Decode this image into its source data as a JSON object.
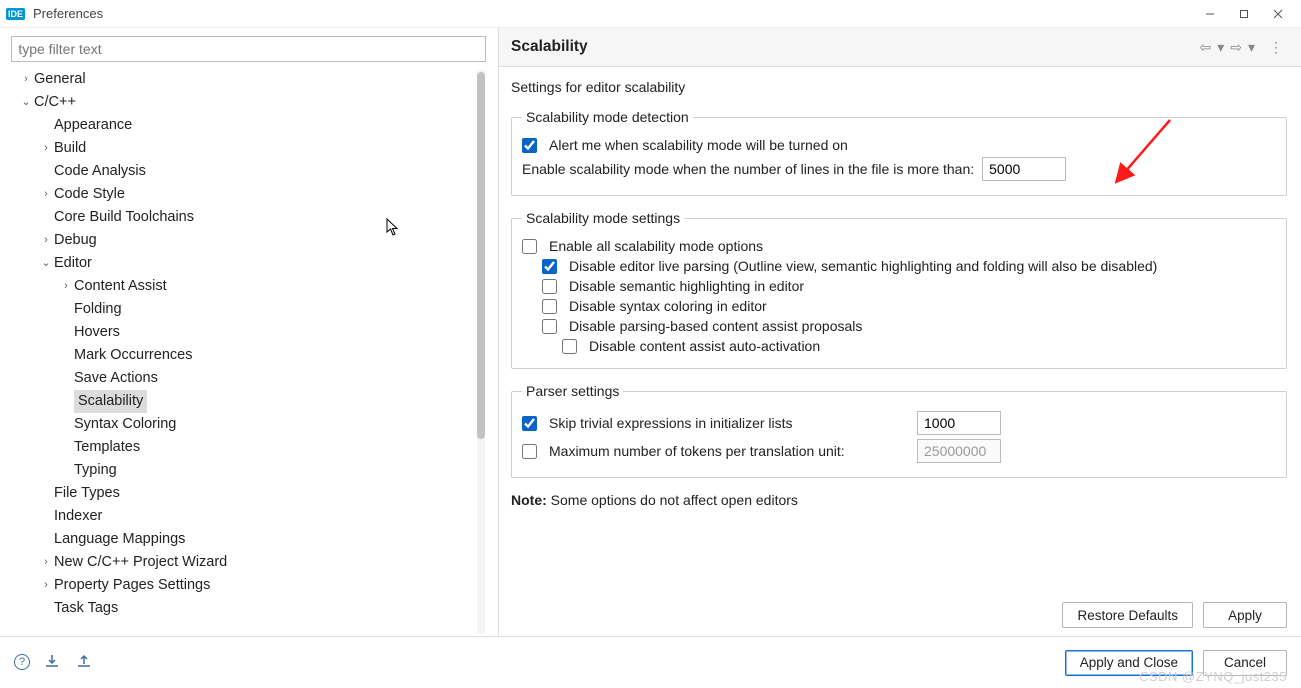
{
  "window": {
    "title": "Preferences"
  },
  "filter_placeholder": "type filter text",
  "tree": {
    "general": "General",
    "ccpp": "C/C++",
    "appearance": "Appearance",
    "build": "Build",
    "code_analysis": "Code Analysis",
    "code_style": "Code Style",
    "core_build": "Core Build Toolchains",
    "debug": "Debug",
    "editor": "Editor",
    "content_assist": "Content Assist",
    "folding": "Folding",
    "hovers": "Hovers",
    "mark_occ": "Mark Occurrences",
    "save_actions": "Save Actions",
    "scalability": "Scalability",
    "syntax_coloring": "Syntax Coloring",
    "templates": "Templates",
    "typing": "Typing",
    "file_types": "File Types",
    "indexer": "Indexer",
    "lang_map": "Language Mappings",
    "new_proj": "New C/C++ Project Wizard",
    "prop_pages": "Property Pages Settings",
    "task_tags": "Task Tags"
  },
  "page": {
    "title": "Scalability",
    "intro": "Settings for editor scalability",
    "g1_title": "Scalability mode detection",
    "alert_label": "Alert me when scalability mode will be turned on",
    "enable_when_label": "Enable scalability mode when the number of lines in the file is more than:",
    "enable_when_value": "5000",
    "g2_title": "Scalability mode settings",
    "enable_all": "Enable all scalability mode options",
    "disable_parsing": "Disable editor live parsing (Outline view, semantic highlighting and folding will also be disabled)",
    "disable_semantic": "Disable semantic highlighting in editor",
    "disable_syntax": "Disable syntax coloring in editor",
    "disable_proposals": "Disable parsing-based content assist proposals",
    "disable_autoact": "Disable content assist auto-activation",
    "g3_title": "Parser settings",
    "skip_trivial": "Skip trivial expressions in initializer lists",
    "skip_trivial_value": "1000",
    "max_tokens": "Maximum number of tokens per translation unit:",
    "max_tokens_value": "25000000",
    "note_prefix": "Note:",
    "note_text": " Some options do not affect open editors"
  },
  "buttons": {
    "restore": "Restore Defaults",
    "apply": "Apply",
    "apply_close": "Apply and Close",
    "cancel": "Cancel"
  },
  "watermark": "CSDN @ZYNQ_just235"
}
